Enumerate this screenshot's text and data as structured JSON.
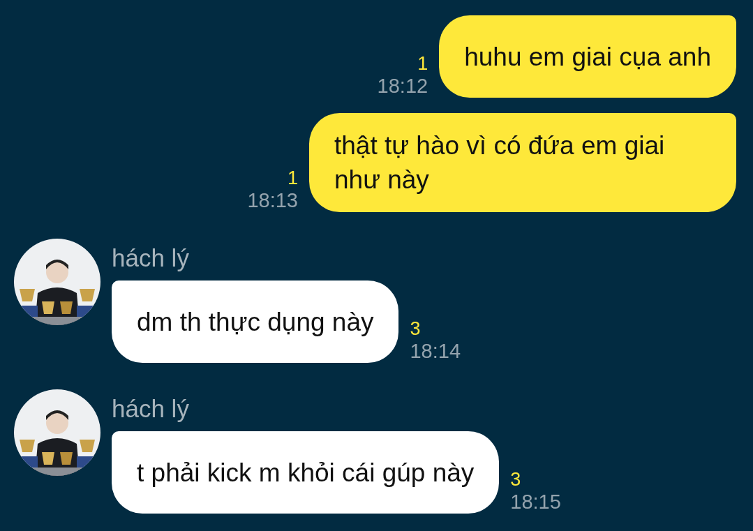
{
  "messages": [
    {
      "kind": "sent",
      "text": "huhu em giai cụa anh",
      "unread": "1",
      "time": "18:12"
    },
    {
      "kind": "sent",
      "text": "thật tự hào vì có đứa em giai như này",
      "unread": "1",
      "time": "18:13"
    },
    {
      "kind": "received",
      "sender": "hách lý",
      "text": "dm th thực dụng này",
      "unread": "3",
      "time": "18:14"
    },
    {
      "kind": "received",
      "sender": "hách lý",
      "text": "t phải kick m khỏi cái gúp này",
      "unread": "3",
      "time": "18:15"
    }
  ]
}
